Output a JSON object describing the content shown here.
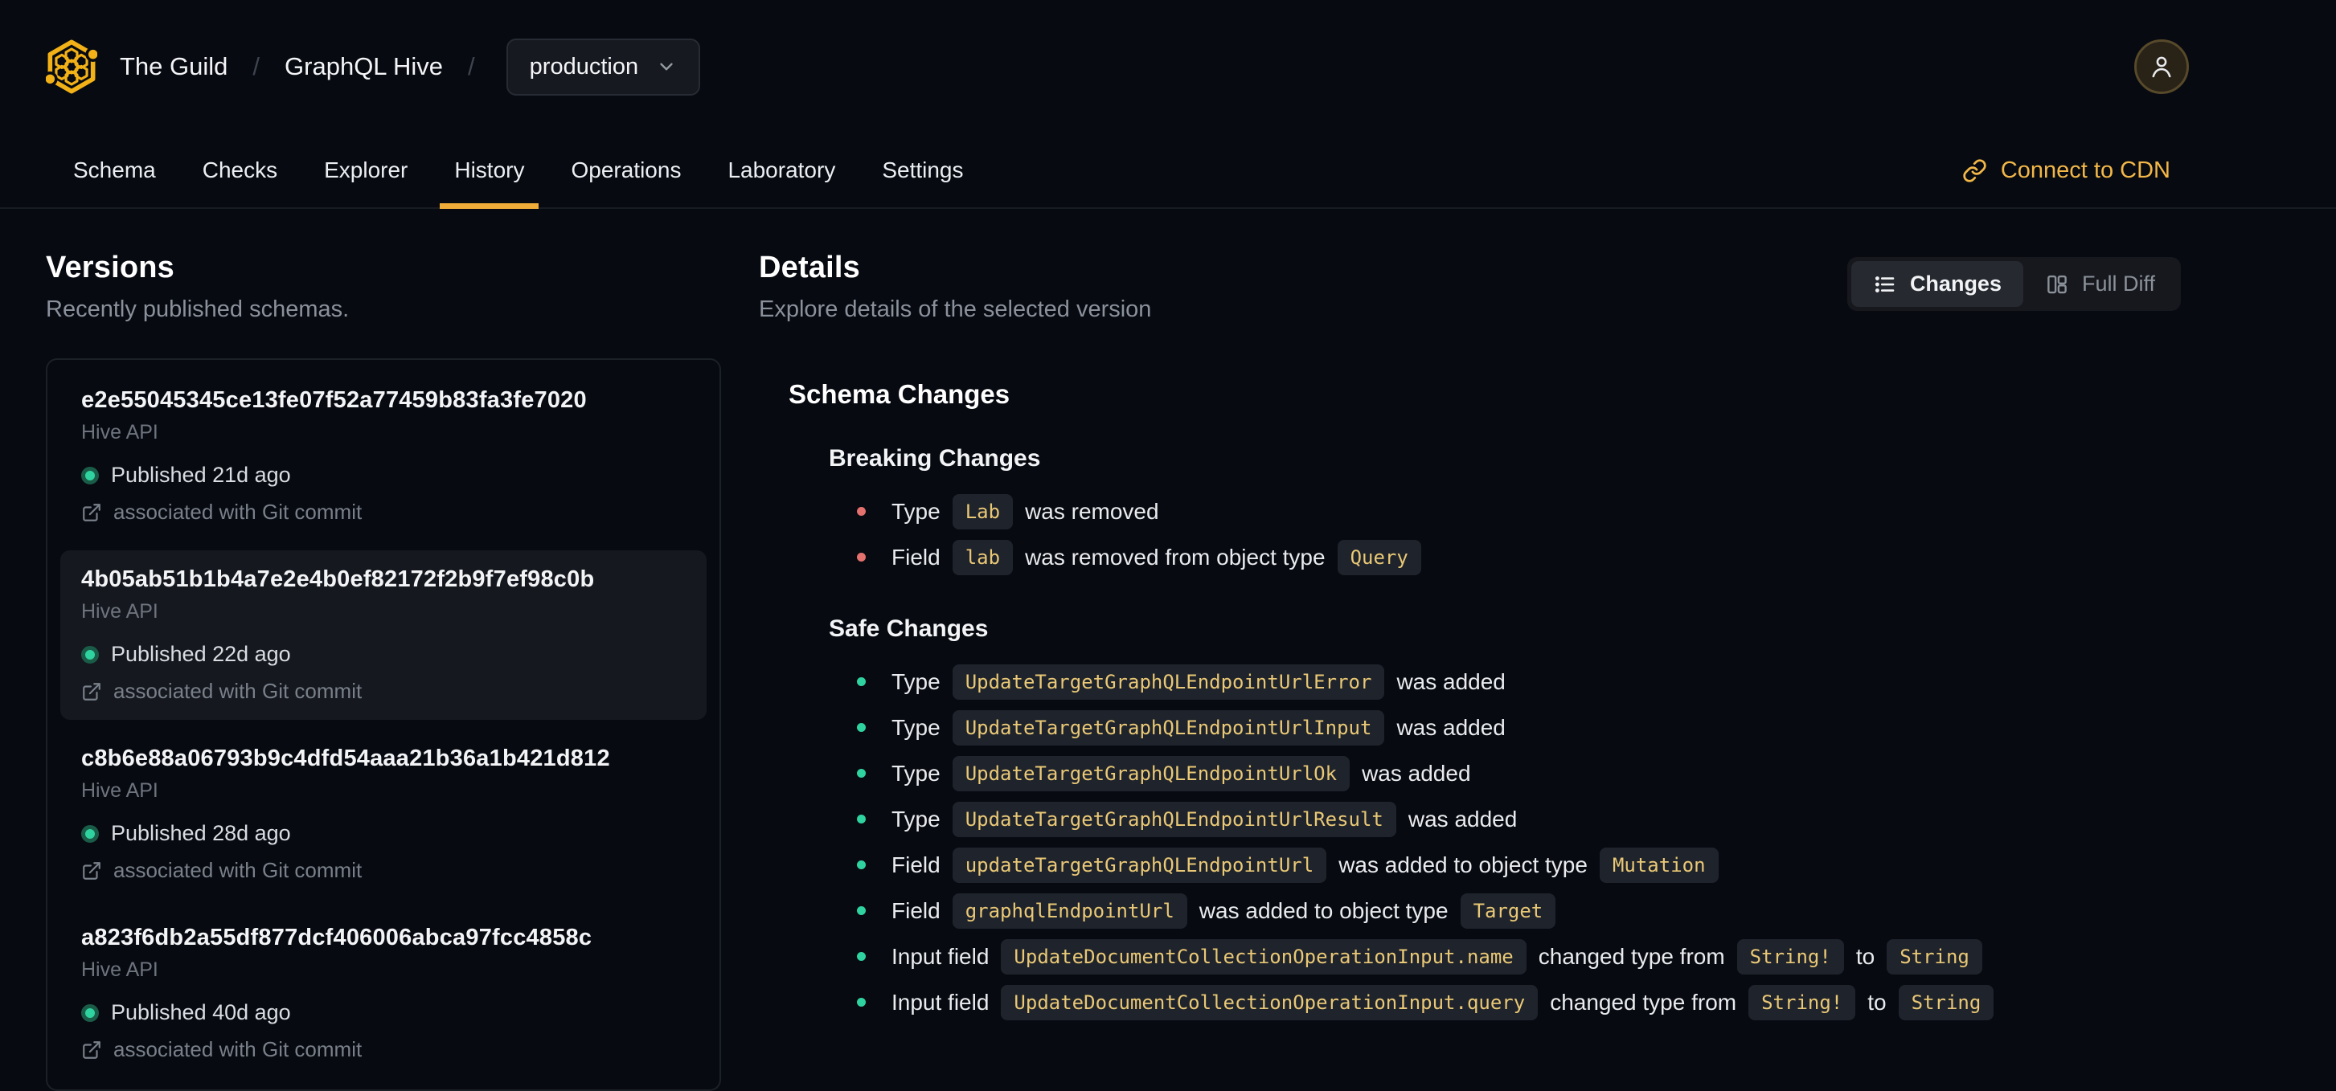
{
  "header": {
    "org": "The Guild",
    "separator": "/",
    "project": "GraphQL Hive",
    "target_selector": {
      "value": "production"
    },
    "nav": [
      {
        "label": "Schema",
        "active": false
      },
      {
        "label": "Checks",
        "active": false
      },
      {
        "label": "Explorer",
        "active": false
      },
      {
        "label": "History",
        "active": true
      },
      {
        "label": "Operations",
        "active": false
      },
      {
        "label": "Laboratory",
        "active": false
      },
      {
        "label": "Settings",
        "active": false
      }
    ],
    "cdn_label": "Connect to CDN"
  },
  "versions": {
    "title": "Versions",
    "subtitle": "Recently published schemas.",
    "items": [
      {
        "hash": "e2e55045345ce13fe07f52a77459b83fa3fe7020",
        "service": "Hive API",
        "published": "Published 21d ago",
        "git": "associated with Git commit",
        "selected": false
      },
      {
        "hash": "4b05ab51b1b4a7e2e4b0ef82172f2b9f7ef98c0b",
        "service": "Hive API",
        "published": "Published 22d ago",
        "git": "associated with Git commit",
        "selected": true
      },
      {
        "hash": "c8b6e88a06793b9c4dfd54aaa21b36a1b421d812",
        "service": "Hive API",
        "published": "Published 28d ago",
        "git": "associated with Git commit",
        "selected": false
      },
      {
        "hash": "a823f6db2a55df877dcf406006abca97fcc4858c",
        "service": "Hive API",
        "published": "Published 40d ago",
        "git": "associated with Git commit",
        "selected": false
      }
    ]
  },
  "details": {
    "title": "Details",
    "subtitle": "Explore details of the selected version",
    "toggle": {
      "changes": "Changes",
      "full_diff": "Full Diff",
      "active": "Changes"
    }
  },
  "schema_changes": {
    "title": "Schema Changes",
    "breaking": {
      "title": "Breaking Changes",
      "items": [
        {
          "segments": [
            {
              "type": "text",
              "value": "Type"
            },
            {
              "type": "code",
              "value": "Lab"
            },
            {
              "type": "text",
              "value": "was removed"
            }
          ]
        },
        {
          "segments": [
            {
              "type": "text",
              "value": "Field"
            },
            {
              "type": "code",
              "value": "lab"
            },
            {
              "type": "text",
              "value": "was removed from object type"
            },
            {
              "type": "code",
              "value": "Query"
            }
          ]
        }
      ]
    },
    "safe": {
      "title": "Safe Changes",
      "items": [
        {
          "segments": [
            {
              "type": "text",
              "value": "Type"
            },
            {
              "type": "code",
              "value": "UpdateTargetGraphQLEndpointUrlError"
            },
            {
              "type": "text",
              "value": "was added"
            }
          ]
        },
        {
          "segments": [
            {
              "type": "text",
              "value": "Type"
            },
            {
              "type": "code",
              "value": "UpdateTargetGraphQLEndpointUrlInput"
            },
            {
              "type": "text",
              "value": "was added"
            }
          ]
        },
        {
          "segments": [
            {
              "type": "text",
              "value": "Type"
            },
            {
              "type": "code",
              "value": "UpdateTargetGraphQLEndpointUrlOk"
            },
            {
              "type": "text",
              "value": "was added"
            }
          ]
        },
        {
          "segments": [
            {
              "type": "text",
              "value": "Type"
            },
            {
              "type": "code",
              "value": "UpdateTargetGraphQLEndpointUrlResult"
            },
            {
              "type": "text",
              "value": "was added"
            }
          ]
        },
        {
          "segments": [
            {
              "type": "text",
              "value": "Field"
            },
            {
              "type": "code",
              "value": "updateTargetGraphQLEndpointUrl"
            },
            {
              "type": "text",
              "value": "was added to object type"
            },
            {
              "type": "code",
              "value": "Mutation"
            }
          ]
        },
        {
          "segments": [
            {
              "type": "text",
              "value": "Field"
            },
            {
              "type": "code",
              "value": "graphqlEndpointUrl"
            },
            {
              "type": "text",
              "value": "was added to object type"
            },
            {
              "type": "code",
              "value": "Target"
            }
          ]
        },
        {
          "segments": [
            {
              "type": "text",
              "value": "Input field"
            },
            {
              "type": "code",
              "value": "UpdateDocumentCollectionOperationInput.name"
            },
            {
              "type": "text",
              "value": "changed type from"
            },
            {
              "type": "code",
              "value": "String!"
            },
            {
              "type": "text",
              "value": "to"
            },
            {
              "type": "code",
              "value": "String"
            }
          ]
        },
        {
          "segments": [
            {
              "type": "text",
              "value": "Input field"
            },
            {
              "type": "code",
              "value": "UpdateDocumentCollectionOperationInput.query"
            },
            {
              "type": "text",
              "value": "changed type from"
            },
            {
              "type": "code",
              "value": "String!"
            },
            {
              "type": "text",
              "value": "to"
            },
            {
              "type": "code",
              "value": "String"
            }
          ]
        }
      ]
    }
  },
  "colors": {
    "background": "#070a11",
    "accent_amber": "#f0ac38",
    "cdn_link": "#f2b748",
    "published_dot": "#2fd3a0",
    "breaking_bullet": "#e4716e",
    "safe_bullet": "#2fd3a0",
    "chip_text": "#e9c876",
    "chip_bg": "#1f232b",
    "selected_item_bg": "#15181f"
  }
}
